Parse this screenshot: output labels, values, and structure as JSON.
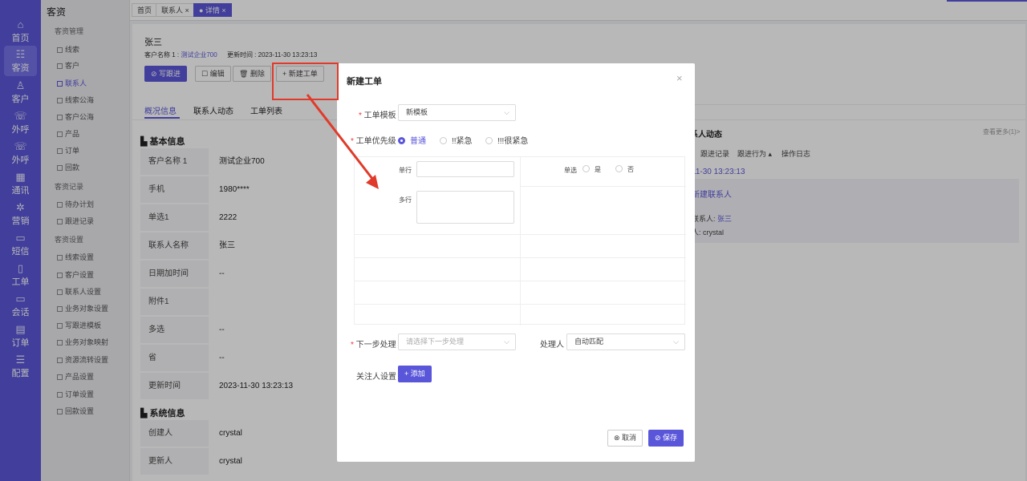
{
  "rail": [
    {
      "label": "首页",
      "icon": "home-icon",
      "glyph": "⌂"
    },
    {
      "label": "客资",
      "icon": "users-icon",
      "glyph": "☷"
    },
    {
      "label": "客户",
      "icon": "person-icon",
      "glyph": "♙"
    },
    {
      "label": "外呼",
      "icon": "phone-out-icon",
      "glyph": "☏"
    },
    {
      "label": "外呼",
      "icon": "phone-callback-icon",
      "glyph": "☏"
    },
    {
      "label": "通讯",
      "icon": "contacts-icon",
      "glyph": "▦"
    },
    {
      "label": "营销",
      "icon": "gear-icon",
      "glyph": "✲"
    },
    {
      "label": "短信",
      "icon": "message-icon",
      "glyph": "▭"
    },
    {
      "label": "工单",
      "icon": "clipboard-icon",
      "glyph": "▯"
    },
    {
      "label": "会话",
      "icon": "chat-icon",
      "glyph": "▭"
    },
    {
      "label": "订单",
      "icon": "order-icon",
      "glyph": "▤"
    },
    {
      "label": "配置",
      "icon": "settings-icon",
      "glyph": "☰"
    }
  ],
  "sidebar": {
    "title": "客资",
    "groups": [
      {
        "label": "客资管理",
        "items": [
          "线索",
          "客户",
          "联系人",
          "线索公海",
          "客户公海",
          "产品",
          "订单",
          "回款"
        ]
      },
      {
        "label": "客资记录",
        "items": [
          "待办计划",
          "跟进记录"
        ]
      },
      {
        "label": "客资设置",
        "items": [
          "线索设置",
          "客户设置",
          "联系人设置",
          "业务对象设置",
          "写跟进模板",
          "业务对象映射",
          "资源流转设置",
          "产品设置",
          "订单设置",
          "回款设置"
        ]
      }
    ],
    "active_item": "联系人"
  },
  "tabs": [
    {
      "label": "首页"
    },
    {
      "label": "联系人 ×"
    },
    {
      "label": "● 详情 ×"
    }
  ],
  "detail": {
    "name": "张三",
    "customer_label": "客户名称 1 :",
    "customer_value": "测试企业700",
    "updated_label": "更新时间 : 2023-11-30 13:23:13",
    "buttons": {
      "follow": "⊘ 写跟进",
      "edit": "☐ 编辑",
      "delete": "🗑 删除",
      "new_ticket": "+ 新建工单"
    },
    "sub_tabs": [
      "概况信息",
      "联系人动态",
      "工单列表"
    ],
    "basic_title": "基本信息",
    "basic_rows": [
      {
        "label": "客户名称 1",
        "value": "测试企业700"
      },
      {
        "label": "手机",
        "value": "1980****"
      },
      {
        "label": "单选1",
        "value": "2222"
      },
      {
        "label": "联系人名称",
        "value": "张三"
      },
      {
        "label": "日期加时间",
        "value": "--"
      },
      {
        "label": "附件1",
        "value": ""
      },
      {
        "label": "多选",
        "value": "--"
      },
      {
        "label": "省",
        "value": "--"
      },
      {
        "label": "更新时间",
        "value": "2023-11-30 13:23:13"
      }
    ],
    "system_title": "系统信息",
    "system_rows": [
      {
        "label": "创建人",
        "value": "crystal"
      },
      {
        "label": "更新人",
        "value": "crystal"
      }
    ]
  },
  "right_panel": {
    "title": "系人动态",
    "more": "查看更多(1)>",
    "filters": [
      "跟进记录",
      "跟进行为 ▴",
      "操作日志"
    ],
    "date": "11-30 13:23:13",
    "event_title": "新建联系人",
    "line1_label": "联系人:",
    "line1_value": "张三",
    "line2": "人: crystal"
  },
  "modal": {
    "title": "新建工单",
    "template_label": "工单模板",
    "template_value": "新模板",
    "priority_label": "工单优先级",
    "priority_options": [
      "普通",
      "!!紧急",
      "!!!很紧急"
    ],
    "priority_selected": "普通",
    "single_line_label": "单行",
    "multi_line_label": "多行",
    "single_choice_label": "单选",
    "single_choice_options": [
      "是",
      "否"
    ],
    "next_step_label": "下一步处理",
    "next_step_placeholder": "请选择下一步处理",
    "handler_label": "处理人",
    "handler_value": "自动匹配",
    "watcher_label": "关注人设置",
    "add_button": "+ 添加",
    "cancel_button": "⊗ 取消",
    "save_button": "⊘ 保存",
    "close": "×"
  },
  "colors": {
    "accent": "#5a56d9",
    "highlight": "#e03a2a"
  }
}
